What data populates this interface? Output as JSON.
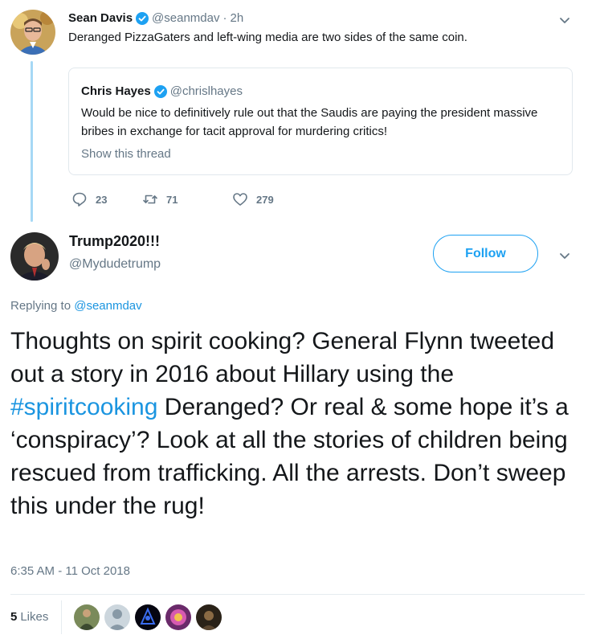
{
  "parent_tweet": {
    "name": "Sean Davis",
    "handle": "@seanmdav",
    "separator": "·",
    "time": "2h",
    "text": "Deranged PizzaGaters and left-wing media are two sides of the same coin.",
    "quote": {
      "name": "Chris Hayes",
      "handle": "@chrislhayes",
      "text": "Would be nice to definitively rule out that the Saudis are paying the president massive bribes in exchange for tacit approval for murdering critics!",
      "show_thread": "Show this thread"
    },
    "actions": {
      "reply_count": "23",
      "retweet_count": "71",
      "like_count": "279"
    }
  },
  "main_tweet": {
    "name": "Trump2020!!!",
    "handle": "@Mydudetrump",
    "follow_label": "Follow",
    "replying_prefix": "Replying to",
    "replying_to": "@seanmdav",
    "text_before": "Thoughts on spirit cooking? General Flynn tweeted out a story in 2016 about Hillary using the ",
    "hashtag": "#spiritcooking",
    "text_after": " Deranged? Or real & some hope it’s a ‘conspiracy’? Look at all the stories of children being rescued from trafficking. All the arrests. Don’t sweep this under the rug!",
    "timestamp": "6:35 AM - 11 Oct 2018",
    "likes_count": "5",
    "likes_label": "Likes"
  },
  "colors": {
    "accent": "#1da1f2",
    "link": "#1b95e0",
    "muted": "#657786",
    "thread_line": "#a6d8f5",
    "border": "#e1e8ed"
  }
}
